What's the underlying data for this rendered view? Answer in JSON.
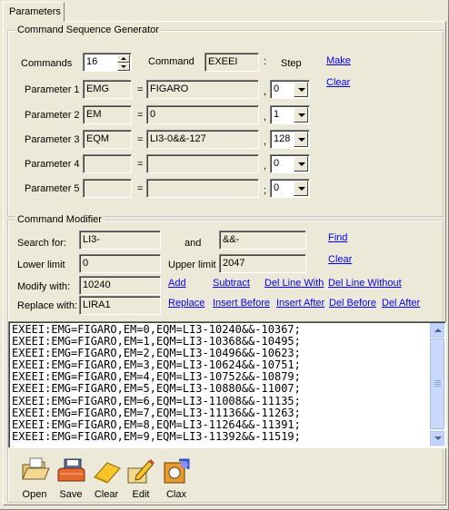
{
  "tab": "Parameters",
  "generator": {
    "title": "Command Sequence Generator",
    "commands_label": "Commands",
    "commands_value": "16",
    "command_label": "Command",
    "command_value": "EXEEI",
    "colon": ":",
    "step_label": "Step",
    "make": "Make",
    "clear": "Clear",
    "params": [
      {
        "label": "Parameter 1",
        "name": "EMG",
        "eq": "=",
        "value": "FIGARO",
        "sep": ",",
        "step": "0"
      },
      {
        "label": "Parameter 2",
        "name": "EM",
        "eq": "=",
        "value": "0",
        "sep": ",",
        "step": "1"
      },
      {
        "label": "Parameter 3",
        "name": "EQM",
        "eq": "=",
        "value": "LI3-0&&-127",
        "sep": ",",
        "step": "128"
      },
      {
        "label": "Parameter 4",
        "name": "",
        "eq": "=",
        "value": "",
        "sep": ",",
        "step": "0"
      },
      {
        "label": "Parameter 5",
        "name": "",
        "eq": "=",
        "value": "",
        "sep": ";",
        "step": "0"
      }
    ]
  },
  "modifier": {
    "title": "Command Modifier",
    "search_label": "Search for:",
    "search_value": "LI3-",
    "and_label": "and",
    "and_value": "&&-",
    "find": "Find",
    "lower_label": "Lower limit",
    "lower_value": "0",
    "upper_label": "Upper limit",
    "upper_value": "2047",
    "clear": "Clear",
    "modify_label": "Modify with:",
    "modify_value": "10240",
    "replace_label": "Replace with:",
    "replace_value": "LIRA1",
    "links1": [
      "Add",
      "Subtract",
      "Del Line With",
      "Del Line Without"
    ],
    "links2": [
      "Replace",
      "Insert Before",
      "Insert After",
      "Del Before",
      "Del After"
    ]
  },
  "output_lines": [
    "EXEEI:EMG=FIGARO,EM=0,EQM=LI3-10240&&-10367;",
    "EXEEI:EMG=FIGARO,EM=1,EQM=LI3-10368&&-10495;",
    "EXEEI:EMG=FIGARO,EM=2,EQM=LI3-10496&&-10623;",
    "EXEEI:EMG=FIGARO,EM=3,EQM=LI3-10624&&-10751;",
    "EXEEI:EMG=FIGARO,EM=4,EQM=LI3-10752&&-10879;",
    "EXEEI:EMG=FIGARO,EM=5,EQM=LI3-10880&&-11007;",
    "EXEEI:EMG=FIGARO,EM=6,EQM=LI3-11008&&-11135;",
    "EXEEI:EMG=FIGARO,EM=7,EQM=LI3-11136&&-11263;",
    "EXEEI:EMG=FIGARO,EM=8,EQM=LI3-11264&&-11391;",
    "EXEEI:EMG=FIGARO,EM=9,EQM=LI3-11392&&-11519;"
  ],
  "toolbar": {
    "open": "Open",
    "save": "Save",
    "clear": "Clear",
    "edit": "Edit",
    "clax": "Clax"
  }
}
